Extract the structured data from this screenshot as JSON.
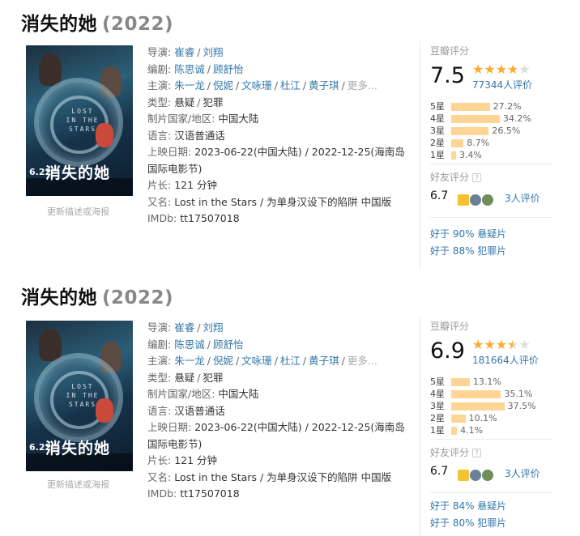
{
  "movies": [
    {
      "title": "消失的她",
      "year": "(2022)",
      "update_link": "更新描述或海报",
      "poster": {
        "text_lines": [
          "LOST",
          "IN THE",
          "STARS"
        ],
        "date": "6.22",
        "name": "消失的她"
      },
      "info": {
        "director_label": "导演:",
        "directors": [
          "崔睿",
          "刘翔"
        ],
        "writer_label": "编剧:",
        "writers": [
          "陈思诚",
          "顾舒怡"
        ],
        "cast_label": "主演:",
        "cast": [
          "朱一龙",
          "倪妮",
          "文咏珊",
          "杜江",
          "黄子琪"
        ],
        "cast_more": "更多...",
        "genre_label": "类型:",
        "genres": [
          "悬疑",
          "犯罪"
        ],
        "country_label": "制片国家/地区:",
        "country": "中国大陆",
        "language_label": "语言:",
        "language": "汉语普通话",
        "release_label": "上映日期:",
        "release": "2023-06-22(中国大陆) / 2022-12-25(海南岛国际电影节)",
        "runtime_label": "片长:",
        "runtime": "121 分钟",
        "aka_label": "又名:",
        "aka": "Lost in the Stars / 为单身汉设下的陷阱 中国版",
        "imdb_label": "IMDb:",
        "imdb": "tt17507018"
      },
      "rating": {
        "label": "豆瓣评分",
        "score": "7.5",
        "stars_value": 3.75,
        "votes": "77344人评价",
        "distribution": [
          {
            "label": "5星",
            "pct": "27.2%",
            "value": 27.2
          },
          {
            "label": "4星",
            "pct": "34.2%",
            "value": 34.2
          },
          {
            "label": "3星",
            "pct": "26.5%",
            "value": 26.5
          },
          {
            "label": "2星",
            "pct": "8.7%",
            "value": 8.7
          },
          {
            "label": "1星",
            "pct": "3.4%",
            "value": 3.4
          }
        ],
        "friend_label": "好友评分",
        "friend_score": "6.7",
        "friend_count": "3人评价",
        "better_than": [
          "好于 90% 悬疑片",
          "好于 88% 犯罪片"
        ]
      }
    },
    {
      "title": "消失的她",
      "year": "(2022)",
      "update_link": "更新描述或海报",
      "poster": {
        "text_lines": [
          "LOST",
          "IN THE",
          "STARS"
        ],
        "date": "6.22",
        "name": "消失的她"
      },
      "info": {
        "director_label": "导演:",
        "directors": [
          "崔睿",
          "刘翔"
        ],
        "writer_label": "编剧:",
        "writers": [
          "陈思诚",
          "顾舒怡"
        ],
        "cast_label": "主演:",
        "cast": [
          "朱一龙",
          "倪妮",
          "文咏珊",
          "杜江",
          "黄子琪"
        ],
        "cast_more": "更多...",
        "genre_label": "类型:",
        "genres": [
          "悬疑",
          "犯罪"
        ],
        "country_label": "制片国家/地区:",
        "country": "中国大陆",
        "language_label": "语言:",
        "language": "汉语普通话",
        "release_label": "上映日期:",
        "release": "2023-06-22(中国大陆) / 2022-12-25(海南岛国际电影节)",
        "runtime_label": "片长:",
        "runtime": "121 分钟",
        "aka_label": "又名:",
        "aka": "Lost in the Stars / 为单身汉设下的陷阱 中国版",
        "imdb_label": "IMDb:",
        "imdb": "tt17507018"
      },
      "rating": {
        "label": "豆瓣评分",
        "score": "6.9",
        "stars_value": 3.5,
        "votes": "181664人评价",
        "distribution": [
          {
            "label": "5星",
            "pct": "13.1%",
            "value": 13.1
          },
          {
            "label": "4星",
            "pct": "35.1%",
            "value": 35.1
          },
          {
            "label": "3星",
            "pct": "37.5%",
            "value": 37.5
          },
          {
            "label": "2星",
            "pct": "10.1%",
            "value": 10.1
          },
          {
            "label": "1星",
            "pct": "4.1%",
            "value": 4.1
          }
        ],
        "friend_label": "好友评分",
        "friend_score": "6.7",
        "friend_count": "3人评价",
        "better_than": [
          "好于 84% 悬疑片",
          "好于 80% 犯罪片"
        ]
      }
    }
  ],
  "colors": {
    "link": "#3377aa",
    "star": "#ffac2d",
    "bar": "#ffd596",
    "muted": "#9b9b9b"
  },
  "icons": {
    "star": "star-icon",
    "help": "help-icon",
    "avatar": "avatar-icon"
  }
}
